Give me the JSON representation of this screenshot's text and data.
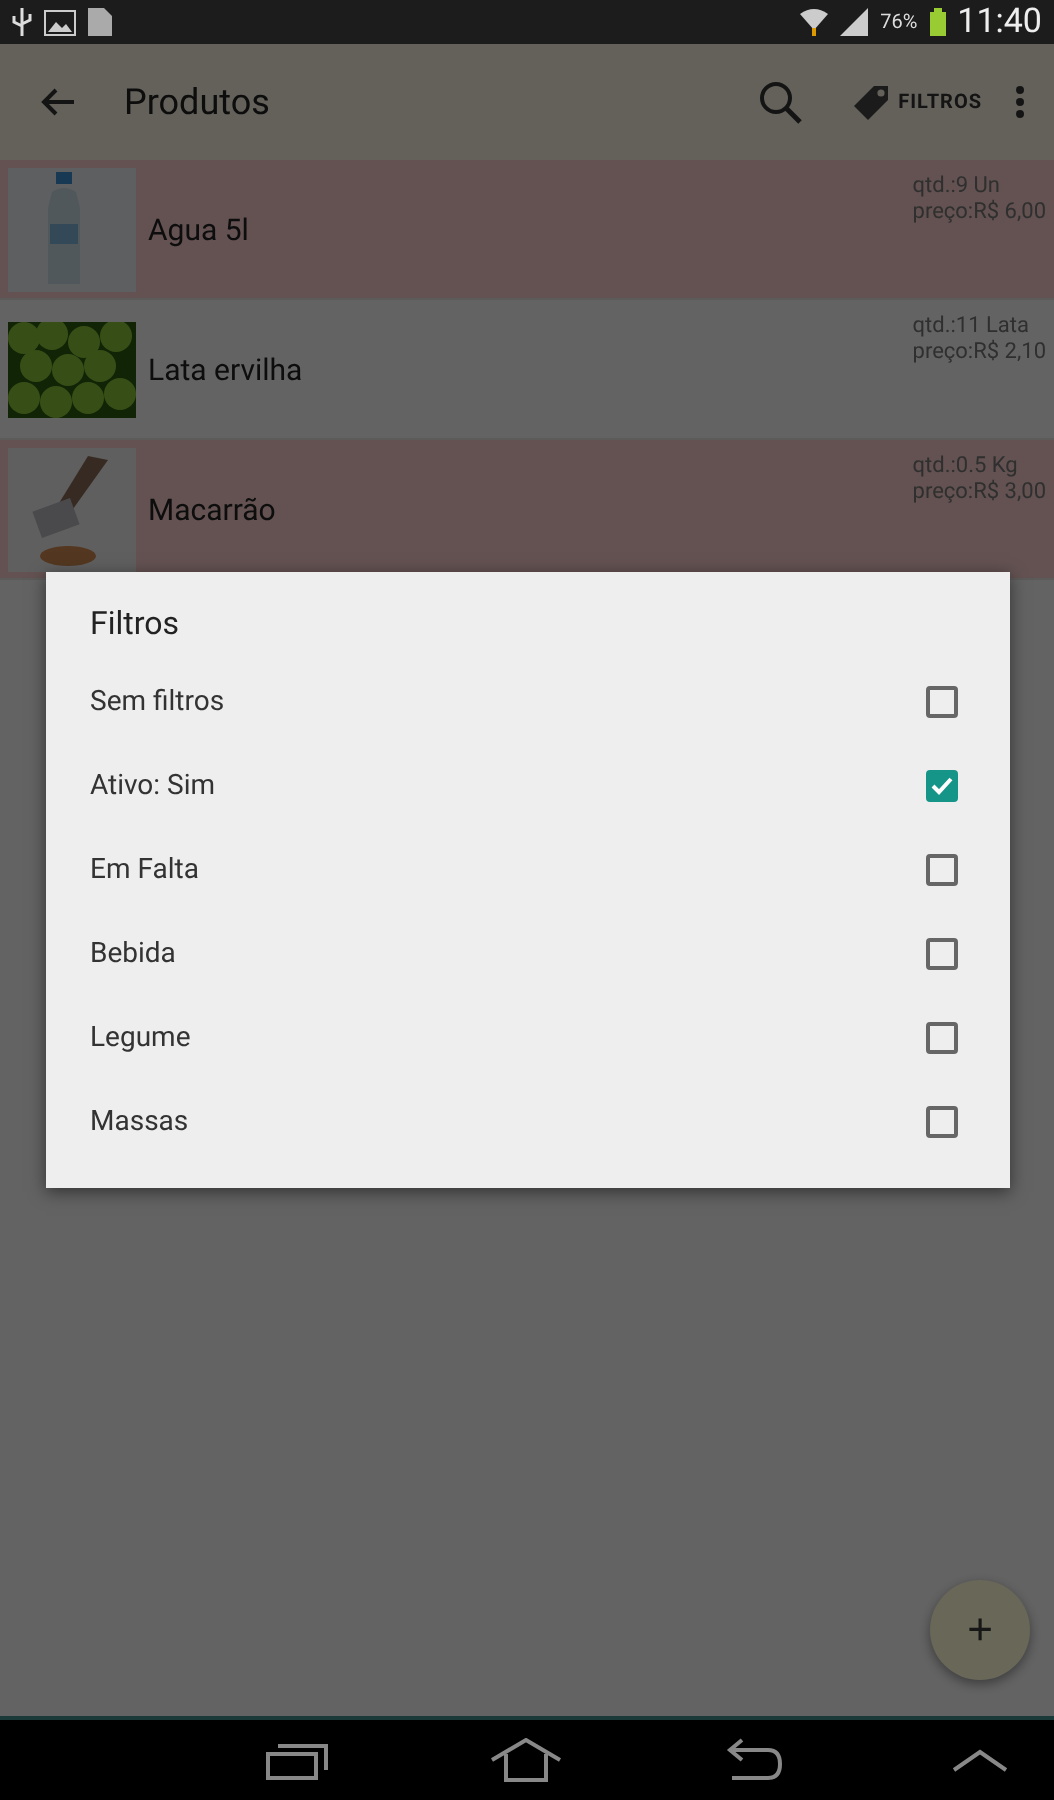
{
  "status_bar": {
    "battery": "76%",
    "time": "11:40"
  },
  "app_bar": {
    "title": "Produtos",
    "filter_action": "FILTROS"
  },
  "products": [
    {
      "name": "Agua 5l",
      "quantity": "qtd.:9 Un",
      "price": "preço:R$ 6,00",
      "highlighted": true
    },
    {
      "name": "Lata ervilha",
      "quantity": "qtd.:11 Lata",
      "price": "preço:R$ 2,10",
      "highlighted": false
    },
    {
      "name": "Macarrão",
      "quantity": "qtd.:0.5 Kg",
      "price": "preço:R$ 3,00",
      "highlighted": true
    }
  ],
  "dialog": {
    "title": "Filtros",
    "options": [
      {
        "label": "Sem filtros",
        "checked": false
      },
      {
        "label": "Ativo: Sim",
        "checked": true
      },
      {
        "label": "Em Falta",
        "checked": false
      },
      {
        "label": "Bebida",
        "checked": false
      },
      {
        "label": "Legume",
        "checked": false
      },
      {
        "label": "Massas",
        "checked": false
      }
    ]
  },
  "fab": {
    "label": "+"
  }
}
